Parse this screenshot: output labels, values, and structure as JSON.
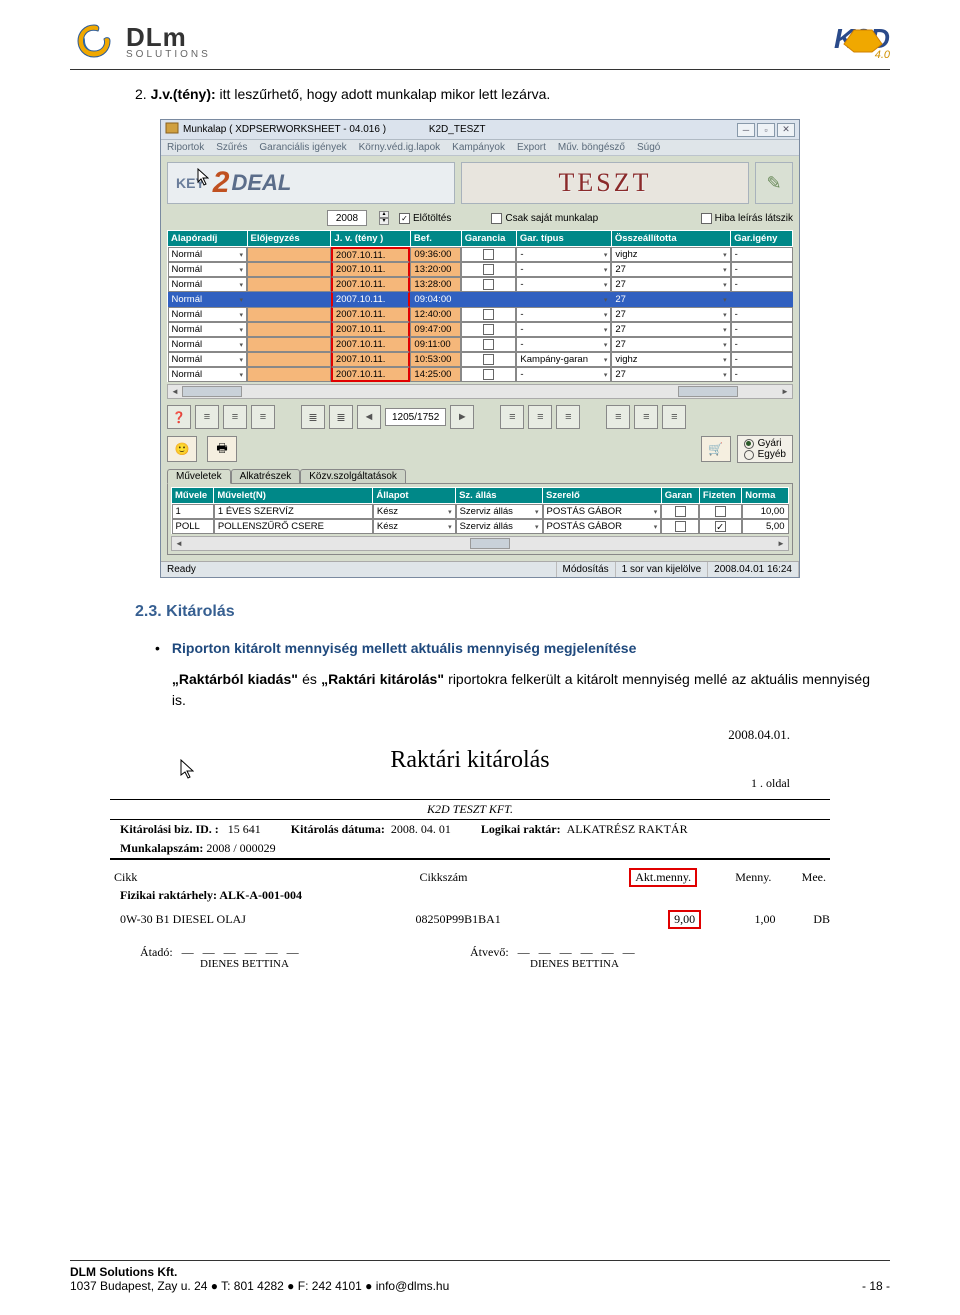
{
  "header": {
    "dlm_name": "DLm",
    "dlm_sub": "SOLUTIONS",
    "k2d": "K2D",
    "k2d_ver": "4.0"
  },
  "doc": {
    "line1_prefix": "2.",
    "line1_bold": "J.v.(tény):",
    "line1_rest": " itt leszűrhető, hogy adott munkalap mikor lett lezárva.",
    "sec_num": "2.3.",
    "sec_title": "Kitárolás",
    "bullet_title": "Riporton kitárolt mennyiség mellett aktuális mennyiség megjelenítése",
    "bullet_body_a": "„Raktárból kiadás\"",
    "bullet_body_mid": " és ",
    "bullet_body_b": "„Raktári kitárolás\"",
    "bullet_body_rest": " riportokra felkerült a kitárolt mennyiség mellé az aktuális mennyiség is."
  },
  "win": {
    "title": "Munkalap ( XDPSERWORKSHEET - 04.016 )",
    "db": "K2D_TESZT",
    "menu": [
      "Riportok",
      "Szűrés",
      "Garanciális igények",
      "Körny.véd.ig.lapok",
      "Kampányok",
      "Export",
      "Műv. böngésző",
      "Súgó"
    ],
    "key_deal": "DEAL",
    "key": "KEY",
    "teszt": "TESZT",
    "year": "2008",
    "filters": {
      "elotoltes": "Előtöltés",
      "csak_sajat": "Csak saját munkalap",
      "hiba_leiras": "Hiba leírás látszik"
    },
    "grid1_headers": [
      "Alapóradíj",
      "Előjegyzés",
      "J. v. (tény )",
      "Bef.",
      "Garancia",
      "Gar. típus",
      "Összeállította",
      "Gar.igény"
    ],
    "grid1_rows": [
      {
        "a": "Normál",
        "d": "2007.10.11.",
        "t": "09:36:00",
        "gt": "-",
        "os": "vighz",
        "gi": "-",
        "sel": false
      },
      {
        "a": "Normál",
        "d": "2007.10.11.",
        "t": "13:20:00",
        "gt": "-",
        "os": "27",
        "gi": "-",
        "sel": false
      },
      {
        "a": "Normál",
        "d": "2007.10.11.",
        "t": "13:28:00",
        "gt": "-",
        "os": "27",
        "gi": "-",
        "sel": false
      },
      {
        "a": "Normál",
        "d": "2007.10.11.",
        "t": "09:04:00",
        "gt": "",
        "os": "27",
        "gi": "",
        "sel": true
      },
      {
        "a": "Normál",
        "d": "2007.10.11.",
        "t": "12:40:00",
        "gt": "-",
        "os": "27",
        "gi": "-",
        "sel": false
      },
      {
        "a": "Normál",
        "d": "2007.10.11.",
        "t": "09:47:00",
        "gt": "-",
        "os": "27",
        "gi": "-",
        "sel": false
      },
      {
        "a": "Normál",
        "d": "2007.10.11.",
        "t": "09:11:00",
        "gt": "-",
        "os": "27",
        "gi": "-",
        "sel": false
      },
      {
        "a": "Normál",
        "d": "2007.10.11.",
        "t": "10:53:00",
        "gt": "Kampány-garan",
        "os": "vighz",
        "gi": "-",
        "sel": false
      },
      {
        "a": "Normál",
        "d": "2007.10.11.",
        "t": "14:25:00",
        "gt": "-",
        "os": "27",
        "gi": "-",
        "sel": false
      }
    ],
    "ratio": "1205/1752",
    "radios": {
      "gyari": "Gyári",
      "egyeb": "Egyéb"
    },
    "tabs": [
      "Műveletek",
      "Alkatrészek",
      "Közv.szolgáltatások"
    ],
    "grid2_headers": [
      "Művele",
      "Művelet(N)",
      "Állapot",
      "Sz. állás",
      "Szerelő",
      "Garan",
      "Fizeten",
      "Norma"
    ],
    "grid2_rows": [
      {
        "m": "1",
        "n": "1 ÉVES SZERVÍZ",
        "a": "Kész",
        "s": "Szerviz állás",
        "sz": "POSTÁS GÁBOR",
        "g": false,
        "f": false,
        "no": "10,00"
      },
      {
        "m": "POLL",
        "n": "POLLENSZŰRŐ CSERE",
        "a": "Kész",
        "s": "Szerviz állás",
        "sz": "POSTÁS GÁBOR",
        "g": false,
        "f": true,
        "no": "5,00"
      }
    ],
    "status": {
      "ready": "Ready",
      "mod": "Módosítás",
      "sel": "1 sor van kijelölve",
      "ts": "2008.04.01 16:24"
    }
  },
  "report": {
    "date": "2008.04.01.",
    "title": "Raktári kitárolás",
    "page": "1 . oldal",
    "company": "K2D TESZT KFT.",
    "kv": {
      "kit_id_lbl": "Kitárolási biz. ID. :",
      "kit_id": "15 641",
      "kit_date_lbl": "Kitárolás dátuma:",
      "kit_date": "2008. 04. 01",
      "log_rakt_lbl": "Logikai raktár:",
      "log_rakt": "ALKATRÉSZ RAKTÁR",
      "munk_lbl": "Munkalapszám:",
      "munk": "2008 / 000029"
    },
    "headers": {
      "cikk": "Cikk",
      "cikkszam": "Cikkszám",
      "akt": "Akt.menny.",
      "menny": "Menny.",
      "mee": "Mee."
    },
    "phys_lbl": "Fizikai raktárhely: ",
    "phys": "ALK-A-001-004",
    "row": {
      "cikk": "0W-30 B1 DIESEL OLAJ",
      "szam": "08250P99B1BA1",
      "akt": "9,00",
      "menny": "1,00",
      "mee": "DB"
    },
    "atado_lbl": "Átadó:",
    "atvevo_lbl": "Átvevő:",
    "name": "DIENES BETTINA"
  },
  "footer": {
    "company": "DLM Solutions Kft.",
    "line": "1037 Budapest, Zay u. 24 ● T: 801 4282 ● F: 242 4101 ● info@dlms.hu",
    "page": "- 18 -"
  }
}
